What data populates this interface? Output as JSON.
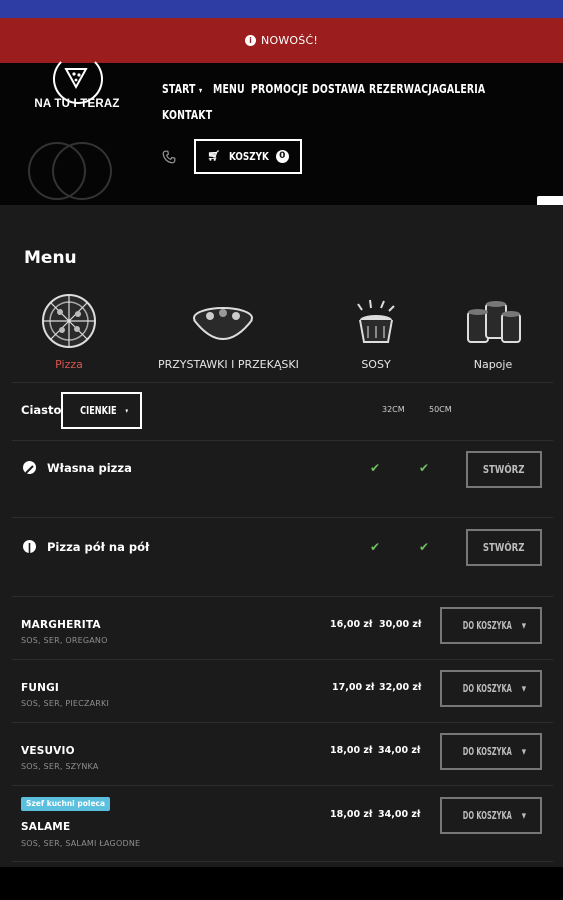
{
  "news_bar": {
    "label": "NOWOŚĆ!"
  },
  "brand": {
    "name": "NA TU I TERAZ"
  },
  "nav": {
    "items": [
      "START",
      "MENU",
      "PROMOCJE",
      "DOSTAWA",
      "REZERWACJA",
      "GALERIA",
      "KONTAKT"
    ],
    "start_caret": "▾"
  },
  "cart": {
    "label": "KOSZYK",
    "count": "0"
  },
  "menu": {
    "title": "Menu",
    "categories": [
      {
        "label": "Pizza",
        "icon": "pizza-icon",
        "active": true
      },
      {
        "label": "PRZYSTAWKI I PRZEKĄSKI",
        "icon": "salad-bowl-icon",
        "active": false
      },
      {
        "label": "SOSY",
        "icon": "sauce-cup-icon",
        "active": false
      },
      {
        "label": "Napoje",
        "icon": "drinks-icon",
        "active": false
      }
    ],
    "dough": {
      "label": "Ciasto",
      "selected": "CIENKIE"
    },
    "sizes": [
      "32CM",
      "50CM"
    ],
    "custom_rows": [
      {
        "title": "Własna pizza",
        "button": "STWÓRZ"
      },
      {
        "title": "Pizza pół na pół",
        "button": "STWÓRZ"
      }
    ],
    "pizzas": [
      {
        "name": "MARGHERITA",
        "desc": "SOS, SER, OREGANO",
        "price_small": "16,00 zł",
        "price_large": "30,00 zł",
        "button": "DO KOSZYKA"
      },
      {
        "name": "FUNGI",
        "desc": "SOS, SER, PIECZARKI",
        "price_small": "17,00 zł",
        "price_large": "32,00 zł",
        "button": "DO KOSZYKA"
      },
      {
        "name": "VESUVIO",
        "desc": "SOS, SER, SZYNKA",
        "price_small": "18,00 zł",
        "price_large": "34,00 zł",
        "button": "DO KOSZYKA"
      },
      {
        "name": "SALAME",
        "desc": "SOS, SER, SALAMI ŁAGODNE",
        "price_small": "18,00 zł",
        "price_large": "34,00 zł",
        "button": "DO KOSZYKA",
        "badge": "Szef kuchni poleca"
      }
    ]
  },
  "colors": {
    "status_bar": "#2d3da3",
    "news_bar": "#9b1d1d",
    "active_category": "#d9534f",
    "check": "#6fbf5e",
    "badge": "#5bc0de"
  }
}
